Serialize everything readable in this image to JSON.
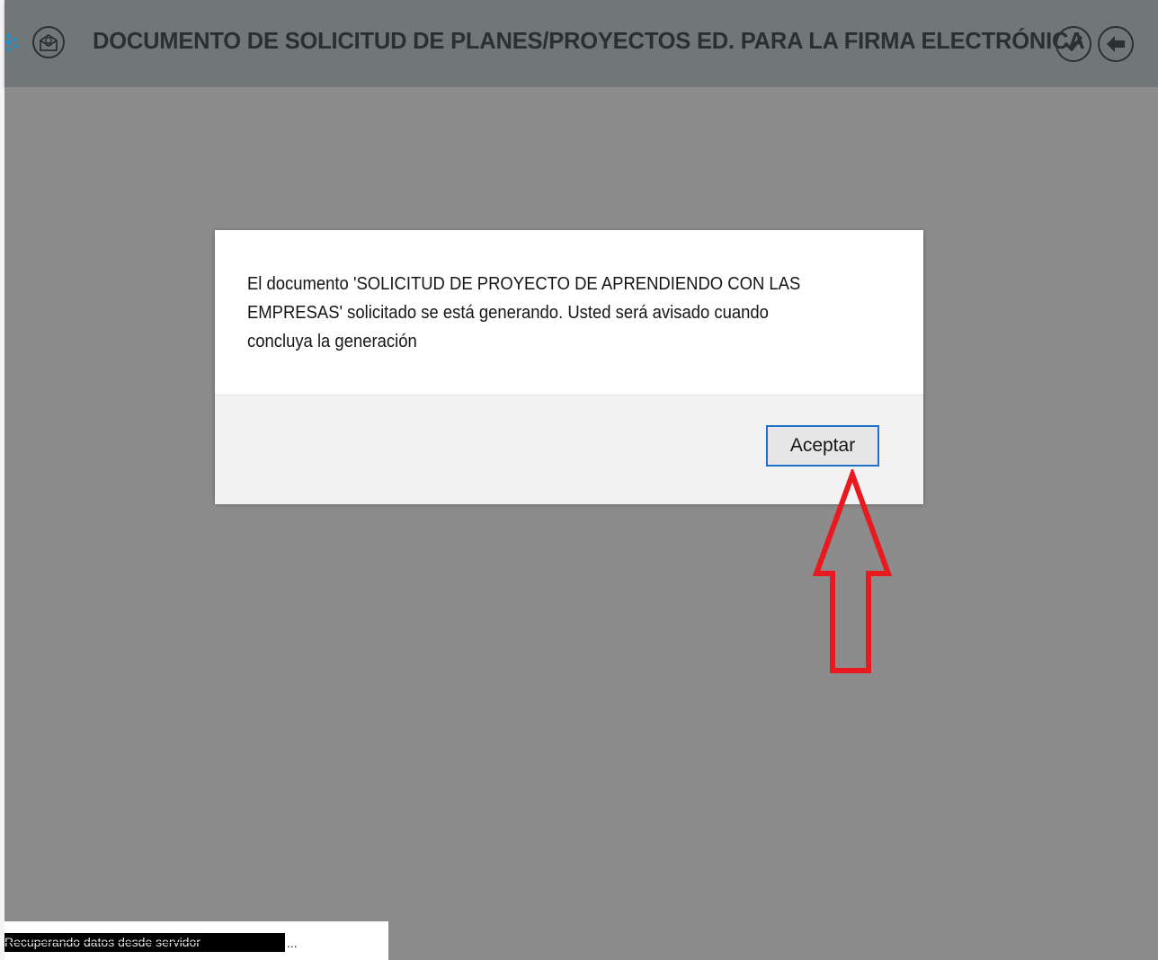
{
  "header": {
    "title": "DOCUMENTO DE SOLICITUD DE PLANES/PROYECTOS ED. PARA LA FIRMA ELECTRÓNICA",
    "left_icon": "envelope-certificate-icon",
    "actions": [
      {
        "name": "confirm",
        "icon": "check-icon"
      },
      {
        "name": "back",
        "icon": "arrow-left-icon"
      }
    ]
  },
  "dialog": {
    "message_line1": "El documento 'SOLICITUD DE PROYECTO DE APRENDIENDO CON LAS",
    "message_line2": "EMPRESAS' solicitado se está generando. Usted será avisado cuando",
    "message_line3": "concluya la generación",
    "accept_label": "Aceptar"
  },
  "status": {
    "text": "Recuperando datos desde servidor",
    "suffix": "..."
  },
  "annotation": {
    "arrow_color": "#e8191f",
    "arrow_direction": "up"
  },
  "colors": {
    "header_bg": "#6f7779",
    "overlay_bg": "#8c8c8c",
    "button_border": "#1e6fc8",
    "gear_accent": "#1e8fc8"
  }
}
